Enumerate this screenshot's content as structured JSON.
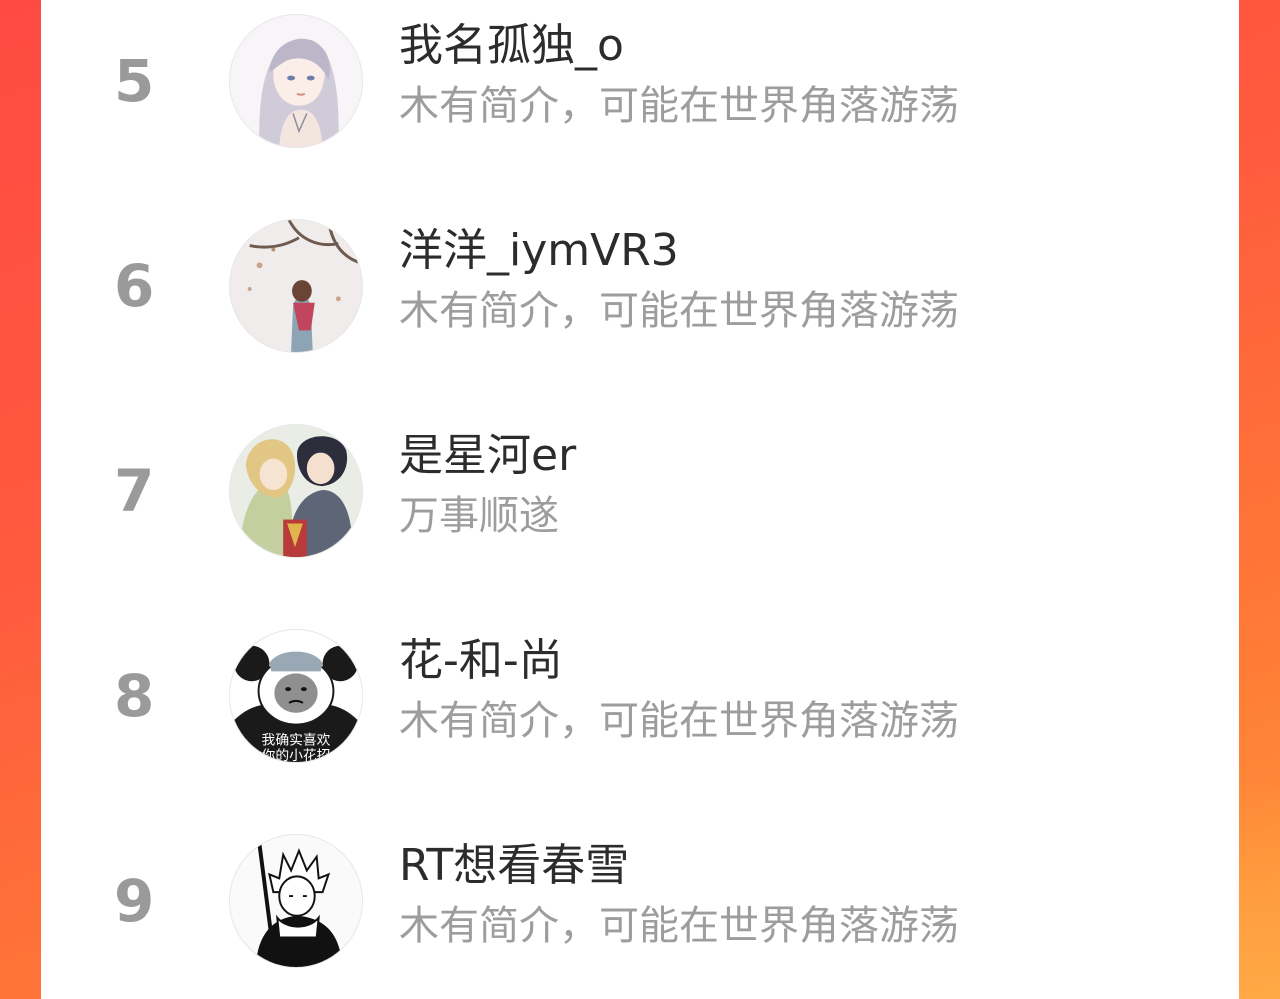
{
  "ranking": {
    "items": [
      {
        "rank": "5",
        "name": "我名孤独_o",
        "bio": "木有简介，可能在世界角落游荡",
        "avatar_icon": "anime-girl-avatar-icon"
      },
      {
        "rank": "6",
        "name": "洋洋_iymVR3",
        "bio": "木有简介，可能在世界角落游荡",
        "avatar_icon": "girl-under-tree-avatar-icon"
      },
      {
        "rank": "7",
        "name": "是星河er",
        "bio": "万事顺遂",
        "avatar_icon": "anime-couple-avatar-icon"
      },
      {
        "rank": "8",
        "name": "花-和-尚",
        "bio": "木有简介，可能在世界角落游荡",
        "avatar_icon": "panda-meme-avatar-icon",
        "avatar_caption": [
          "我确实喜欢",
          "你的小花招"
        ]
      },
      {
        "rank": "9",
        "name": "RT想看春雪",
        "bio": "木有简介，可能在世界角落游荡",
        "avatar_icon": "manga-swordsman-avatar-icon"
      }
    ]
  },
  "colors": {
    "frame_gradient_start": "#ff4a43",
    "frame_gradient_end": "#ff9a3a",
    "rank_number": "#9a9a9a",
    "name_text": "#2c2c2c",
    "bio_text": "#9d9d9d"
  }
}
